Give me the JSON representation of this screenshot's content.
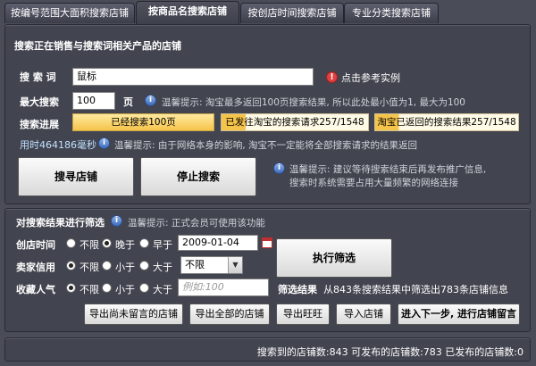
{
  "tabs": [
    {
      "label": "按编号范围大面积搜索店铺",
      "active": false
    },
    {
      "label": "按商品名搜索店铺",
      "active": true
    },
    {
      "label": "按创店时间搜索店铺",
      "active": false
    },
    {
      "label": "专业分类搜索店铺",
      "active": false
    }
  ],
  "search": {
    "section_title": "搜索正在销售与搜索词相关产品的店铺",
    "keyword_label": "搜 索 词",
    "keyword_value": "鼠标",
    "example_link": "点击参考实例",
    "max_label": "最大搜索",
    "max_value": "100",
    "max_unit": "页",
    "max_hint": "温馨提示: 淘宝最多返回100页搜索结果, 所以此处最小值为1, 最大为100",
    "progress_label": "搜索进展",
    "progress_1": "已经搜索100页",
    "progress_2": "已发往淘宝的搜索请求257/1548",
    "progress_3": "淘宝已返回的搜索结果257/1548",
    "elapsed": "用时464186毫秒",
    "elapsed_hint": "温馨提示: 由于网络本身的影响, 淘宝不一定能将全部搜索请求的结果返回",
    "search_button": "搜寻店铺",
    "stop_button": "停止搜索",
    "tip_line1": "温馨提示: 建议等待搜索结束后再发布推广信息,",
    "tip_line2": "搜索时系统需要占用大量频繁的网络连接"
  },
  "filter": {
    "section_title": "对搜索结果进行筛选",
    "section_hint": "温馨提示: 正式会员可使用该功能",
    "opt_none": "不限",
    "opt_after": "晚于",
    "opt_before": "早于",
    "opt_less": "小于",
    "opt_greater": "大于",
    "created_label": "创店时间",
    "created_date": "2009-01-04",
    "credit_label": "卖家信用",
    "credit_select": "不限",
    "popularity_label": "收藏人气",
    "popularity_placeholder": "例如:100",
    "run_button": "执行筛选",
    "result_label": "筛选结果",
    "result_text": "从843条搜索结果中筛选出783条店铺信息",
    "buttons": {
      "export_unmsg": "导出尚未留言的店铺",
      "export_all": "导出全部的店铺",
      "export_ww": "导出旺旺",
      "import": "导入店铺",
      "next": "进入下一步, 进行店铺留言"
    }
  },
  "status_bar": {
    "text": "搜索到的店铺数:843  可发布的店铺数:783  已发布的店铺数:0"
  },
  "colors": {
    "background": "#4a4c58",
    "panel": "#42444f",
    "progress_fill": "#f5c44a",
    "warn": "#e04040",
    "info": "#3c6cc0"
  }
}
